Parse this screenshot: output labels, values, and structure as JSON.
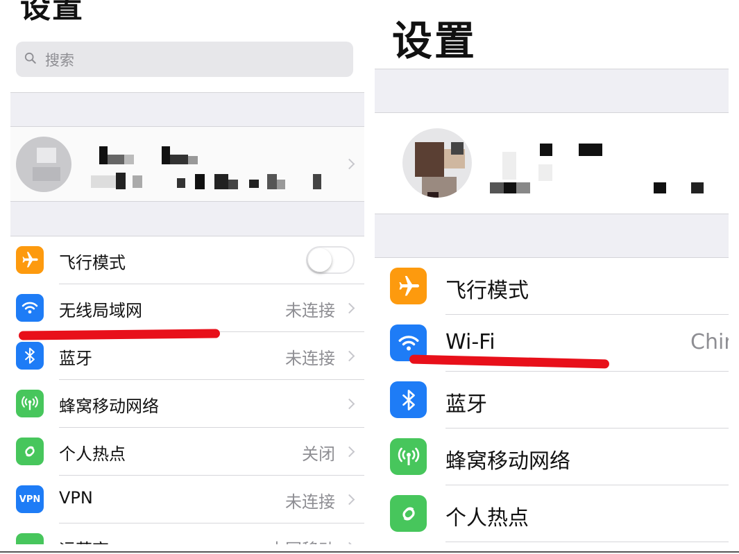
{
  "colors": {
    "orange": "#fd9a0e",
    "blue": "#1e7cf6",
    "green": "#47c65c",
    "annotation_red": "#e8101a",
    "group_gray": "#efeff4"
  },
  "left_screen": {
    "title": "设置",
    "search_placeholder": "搜索",
    "rows": [
      {
        "icon": "airplane-icon",
        "label": "飞行模式",
        "value": "",
        "control": "toggle-off"
      },
      {
        "icon": "wifi-icon",
        "label": "无线局域网",
        "value": "未连接"
      },
      {
        "icon": "bluetooth-icon",
        "label": "蓝牙",
        "value": "未连接"
      },
      {
        "icon": "cellular-icon",
        "label": "蜂窝移动网络",
        "value": ""
      },
      {
        "icon": "hotspot-icon",
        "label": "个人热点",
        "value": "关闭"
      },
      {
        "icon": "vpn-icon",
        "label": "VPN",
        "icon_text": "VPN",
        "value": "未连接"
      },
      {
        "icon": "carrier-icon",
        "label": "运营商",
        "value": "中国移动"
      }
    ]
  },
  "right_screen": {
    "title": "设置",
    "rows": [
      {
        "icon": "airplane-icon",
        "label": "飞行模式"
      },
      {
        "icon": "wifi-icon",
        "label": "Wi-Fi",
        "value": "Chir"
      },
      {
        "icon": "bluetooth-icon",
        "label": "蓝牙"
      },
      {
        "icon": "cellular-icon",
        "label": "蜂窝移动网络"
      },
      {
        "icon": "hotspot-icon",
        "label": "个人热点"
      }
    ]
  }
}
